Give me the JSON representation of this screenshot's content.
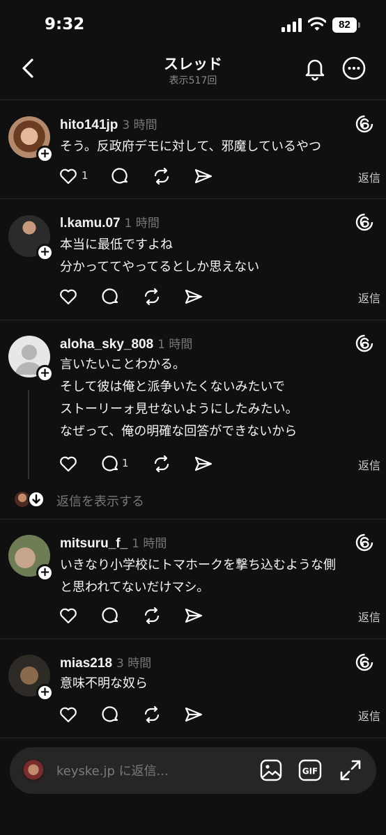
{
  "status_bar": {
    "time": "9:32",
    "battery": "82"
  },
  "header": {
    "title": "スレッド",
    "subtitle": "表示517回"
  },
  "posts": [
    {
      "username": "hito141jp",
      "time_ago": "3 時間",
      "lines": [
        "そう。反政府デモに対して、邪魔しているやつ"
      ],
      "like_count": "1",
      "comment_count": "",
      "reply_label": "返信"
    },
    {
      "username": "l.kamu.07",
      "time_ago": "1 時間",
      "lines": [
        "本当に最低ですよね",
        "分かっててやってるとしか思えない"
      ],
      "like_count": "",
      "comment_count": "",
      "reply_label": "返信"
    },
    {
      "username": "aloha_sky_808",
      "time_ago": "1 時間",
      "lines": [
        "言いたいことわかる。",
        "そして彼は俺と派争いたくないみたいで",
        "ストーリーォ見せないようにしたみたい。",
        "なぜって、俺の明確な回答ができないから"
      ],
      "like_count": "",
      "comment_count": "1",
      "reply_label": "返信"
    },
    {
      "username": "mitsuru_f_",
      "time_ago": "1 時間",
      "lines": [
        "いきなり小学校にトマホークを撃ち込むような側",
        "と思われてないだけマシ。"
      ],
      "like_count": "",
      "comment_count": "",
      "reply_label": "返信"
    },
    {
      "username": "mias218",
      "time_ago": "3 時間",
      "lines": [
        "意味不明な奴ら"
      ],
      "like_count": "",
      "comment_count": "",
      "reply_label": "返信"
    }
  ],
  "show_replies_label": "返信を表示する",
  "reply_bar": {
    "placeholder": "keyske.jp に返信..."
  },
  "icons": [
    "chevron-left-icon",
    "bell-icon",
    "more-icon",
    "threads-icon",
    "heart-icon",
    "comment-icon",
    "repost-icon",
    "share-icon",
    "image-icon",
    "gif-icon",
    "expand-icon"
  ]
}
